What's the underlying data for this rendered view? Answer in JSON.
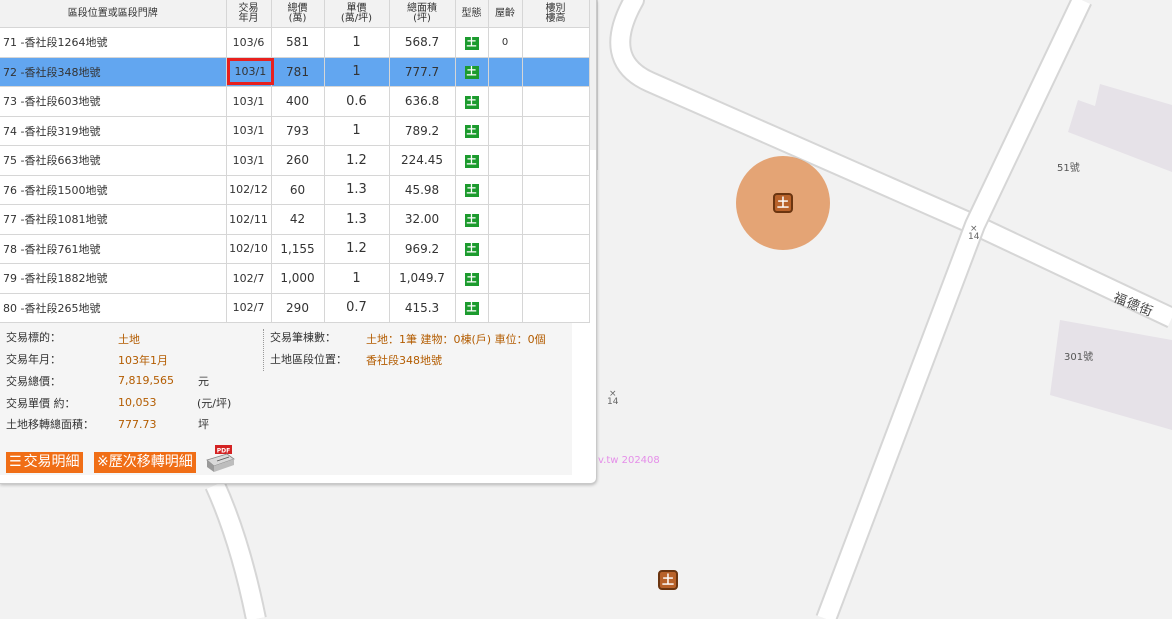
{
  "table": {
    "headers": {
      "location": "區段位置或區段門牌",
      "year_month": [
        "交易",
        "年月"
      ],
      "total_price": [
        "總價",
        "(萬)"
      ],
      "unit_price": [
        "單價",
        "(萬/坪)"
      ],
      "area": [
        "總面積",
        "(坪)"
      ],
      "type": "型態",
      "age": "屋齡",
      "floor": [
        "樓別",
        "樓高"
      ]
    },
    "rows": [
      {
        "no": "71",
        "location": "-香社段1264地號",
        "year_month": "103/6",
        "total": "581",
        "unit": "1",
        "area": "568.7",
        "type": "土",
        "age": "0"
      },
      {
        "no": "72",
        "location": "-香社段348地號",
        "year_month": "103/1",
        "total": "781",
        "unit": "1",
        "area": "777.7",
        "type": "土",
        "age": ""
      },
      {
        "no": "73",
        "location": "-香社段603地號",
        "year_month": "103/1",
        "total": "400",
        "unit": "0.6",
        "area": "636.8",
        "type": "土",
        "age": ""
      },
      {
        "no": "74",
        "location": "-香社段319地號",
        "year_month": "103/1",
        "total": "793",
        "unit": "1",
        "area": "789.2",
        "type": "土",
        "age": ""
      },
      {
        "no": "75",
        "location": "-香社段663地號",
        "year_month": "103/1",
        "total": "260",
        "unit": "1.2",
        "area": "224.45",
        "type": "土",
        "age": ""
      },
      {
        "no": "76",
        "location": "-香社段1500地號",
        "year_month": "102/12",
        "total": "60",
        "unit": "1.3",
        "area": "45.98",
        "type": "土",
        "age": ""
      },
      {
        "no": "77",
        "location": "-香社段1081地號",
        "year_month": "102/11",
        "total": "42",
        "unit": "1.3",
        "area": "32.00",
        "type": "土",
        "age": ""
      },
      {
        "no": "78",
        "location": "-香社段761地號",
        "year_month": "102/10",
        "total": "1,155",
        "unit": "1.2",
        "area": "969.2",
        "type": "土",
        "age": ""
      },
      {
        "no": "79",
        "location": "-香社段1882地號",
        "year_month": "102/7",
        "total": "1,000",
        "unit": "1",
        "area": "1,049.7",
        "type": "土",
        "age": ""
      },
      {
        "no": "80",
        "location": "-香社段265地號",
        "year_month": "102/7",
        "total": "290",
        "unit": "0.7",
        "area": "415.3",
        "type": "土",
        "age": ""
      }
    ],
    "selected_row": 1
  },
  "detail": {
    "subject_label": "交易標的：",
    "subject_value": "土地",
    "ym_label": "交易年月：",
    "ym_value": "103年1月",
    "total_label": "交易總價：",
    "total_value": "7,819,565",
    "total_unit": "元",
    "unit_label": "交易單價 約：",
    "unit_value": "10,053",
    "unit_unit": "(元/坪)",
    "area_label": "土地移轉總面積：",
    "area_value": "777.73",
    "area_unit": "坪",
    "count_label": "交易筆棟數：",
    "count_value": "土地：1筆 建物：0棟(戶) 車位：0個",
    "pos_label": "土地區段位置：",
    "pos_value": "香社段348地號"
  },
  "buttons": {
    "detail": "交易明細",
    "history": "※歷次移轉明細",
    "pdf_badge": "PDF"
  },
  "map": {
    "label_51": "51號",
    "label_301": "301號",
    "street": "福德街",
    "marker_14a": "14",
    "marker_14b": "14",
    "watermark": "v.tw 202408",
    "cluster_marker": "土",
    "single_marker": "土"
  },
  "colors": {
    "selected_row": "#62a6f0",
    "orange_button": "#f06e16",
    "detail_value": "#b35c00",
    "land_icon": "#1c9b2e",
    "highlight": "#e8201e",
    "cluster": "#e0925a"
  }
}
